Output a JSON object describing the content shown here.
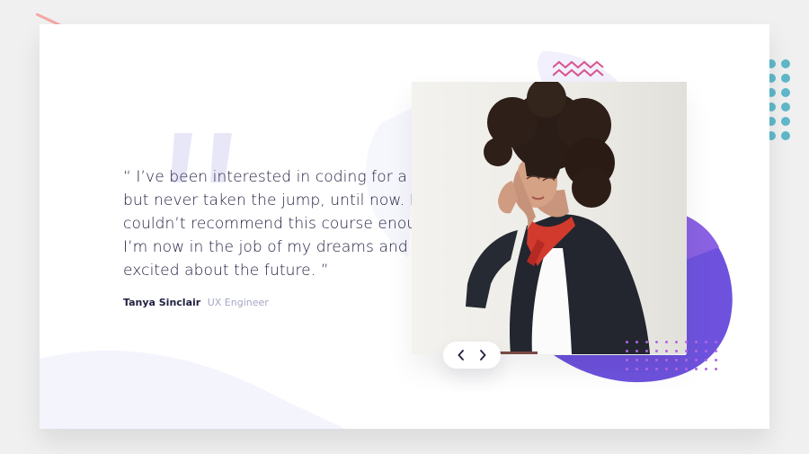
{
  "testimonial": {
    "quote_lines": [
      "“ I’ve been interested in coding for a while",
      "but never taken the jump, until now. I",
      "couldn’t recommend this course enough.",
      "I’m now in the job of my dreams and so",
      "excited about the future. ”"
    ],
    "author_name": "Tanya Sinclair",
    "author_role": "UX Engineer"
  },
  "controls": {
    "prev_icon": "chevron-left-icon",
    "next_icon": "chevron-right-icon"
  },
  "colors": {
    "background": "#f0f0f1",
    "text_dark": "#202041",
    "text_muted": "#a6a7c4",
    "accent_purple": "#6c4ee2",
    "accent_pink": "#d8558c",
    "accent_teal": "#5fb8c9"
  }
}
